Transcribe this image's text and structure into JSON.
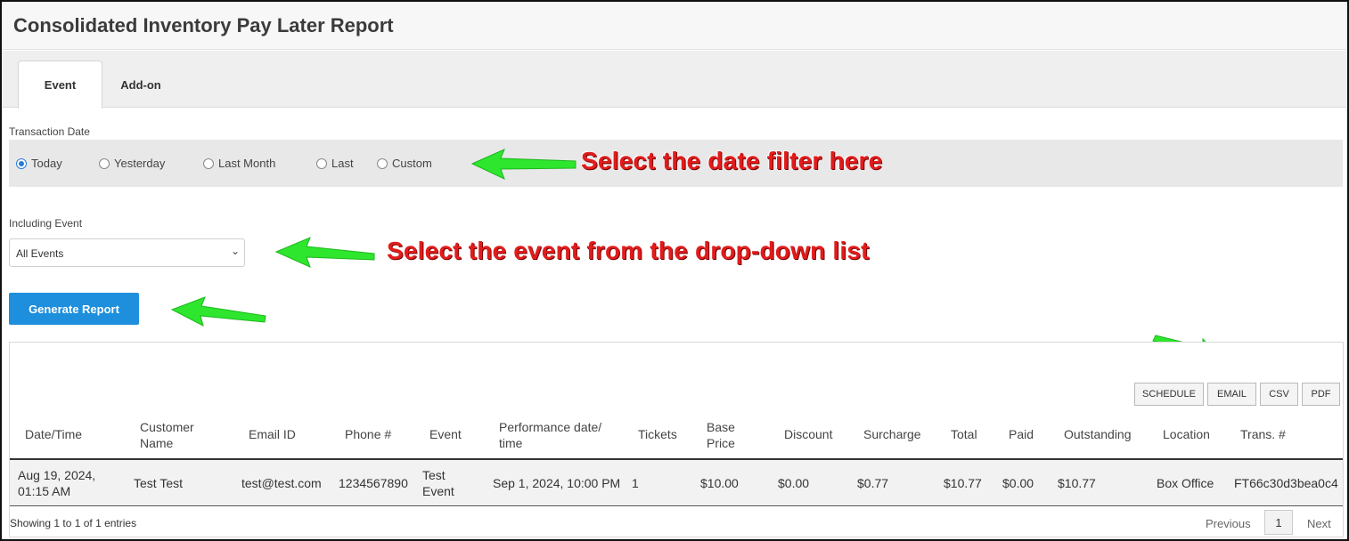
{
  "page": {
    "title": "Consolidated Inventory Pay Later Report"
  },
  "tabs": [
    {
      "label": "Event",
      "active": true
    },
    {
      "label": "Add-on",
      "active": false
    }
  ],
  "filters": {
    "transaction_date_label": "Transaction Date",
    "date_options": [
      {
        "label": "Today",
        "selected": true
      },
      {
        "label": "Yesterday",
        "selected": false
      },
      {
        "label": "Last Month",
        "selected": false
      },
      {
        "label": "Last",
        "selected": false
      },
      {
        "label": "Custom",
        "selected": false
      }
    ],
    "including_event_label": "Including Event",
    "event_select_value": "All Events",
    "generate_button": "Generate Report"
  },
  "annotations": {
    "date_hint": "Select the date filter here",
    "event_hint": "Select the event from the drop-down list",
    "arrow_color": "#2ee62e",
    "text_color": "#e11c1c"
  },
  "export_buttons": [
    "SCHEDULE",
    "EMAIL",
    "CSV",
    "PDF"
  ],
  "table": {
    "columns": [
      "Date/Time",
      "Customer Name",
      "Email ID",
      "Phone #",
      "Event",
      "Performance date/ time",
      "Tickets",
      "Base Price",
      "Discount",
      "Surcharge",
      "Total",
      "Paid",
      "Outstanding",
      "Location",
      "Trans. #"
    ],
    "rows": [
      [
        "Aug 19, 2024, 01:15 AM",
        "Test Test",
        "test@test.com",
        "1234567890",
        "Test Event",
        "Sep 1, 2024, 10:00 PM",
        "1",
        "$10.00",
        "$0.00",
        "$0.77",
        "$10.77",
        "$0.00",
        "$10.77",
        "Box Office",
        "FT66c30d3bea0c4"
      ]
    ]
  },
  "footer": {
    "entries_text": "Showing 1 to 1 of 1 entries",
    "previous": "Previous",
    "page": "1",
    "next": "Next"
  },
  "colors": {
    "primary_button": "#1e8fdc",
    "radio_selected": "#2b7bd4"
  }
}
